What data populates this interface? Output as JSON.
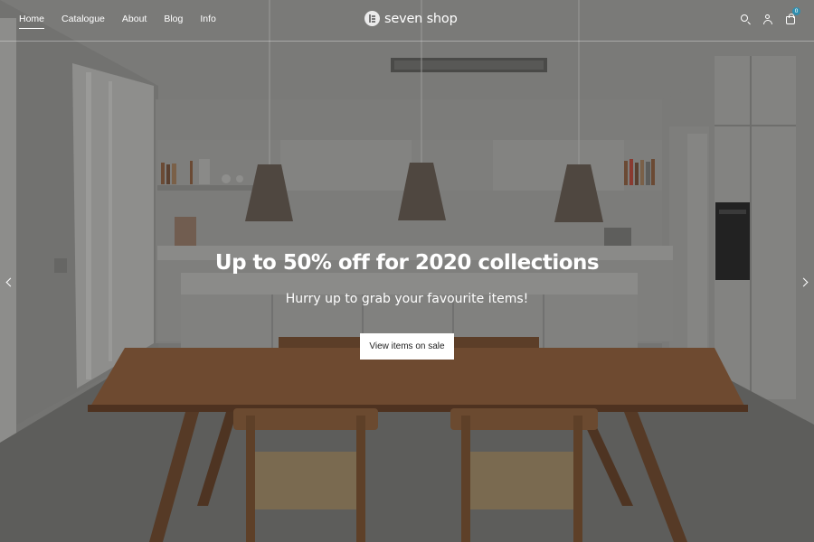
{
  "nav": {
    "items": [
      {
        "label": "Home",
        "active": true
      },
      {
        "label": "Catalogue",
        "active": false
      },
      {
        "label": "About",
        "active": false
      },
      {
        "label": "Blog",
        "active": false
      },
      {
        "label": "Info",
        "active": false
      }
    ]
  },
  "brand": {
    "name": "seven shop",
    "icon": "logo-mark-icon"
  },
  "header_icons": {
    "search": "search-icon",
    "account": "user-icon",
    "cart": "cart-icon",
    "cart_count": "0",
    "badge_color": "#2f8fb0"
  },
  "hero": {
    "headline": "Up to 50% off for 2020 collections",
    "subline": "Hurry up to grab your favourite items!",
    "cta_label": "View items on sale",
    "prev_icon": "chevron-left-icon",
    "next_icon": "chevron-right-icon"
  }
}
